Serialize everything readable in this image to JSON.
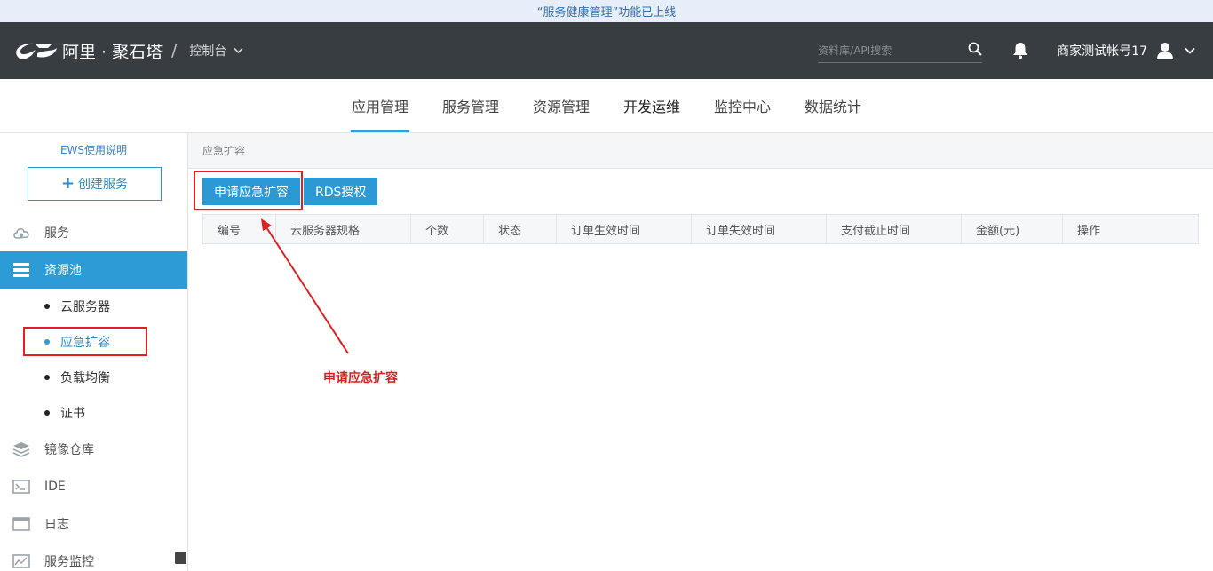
{
  "announcement": "“服务健康管理”功能已上线",
  "header": {
    "brand": "阿里 · 聚石塔",
    "separator": "/",
    "console_label": "控制台",
    "search_placeholder": "资料库/API搜索",
    "account_name": "商家测试帐号17"
  },
  "main_nav": {
    "tabs": [
      {
        "label": "应用管理"
      },
      {
        "label": "服务管理"
      },
      {
        "label": "资源管理"
      },
      {
        "label": "开发运维"
      },
      {
        "label": "监控中心"
      },
      {
        "label": "数据统计"
      }
    ]
  },
  "sidebar": {
    "ews_link": "EWS使用说明",
    "create_plus": "+",
    "create_label": "创建服务",
    "items": [
      {
        "label": "服务"
      },
      {
        "label": "资源池"
      },
      {
        "label": "镜像仓库"
      },
      {
        "label": "IDE"
      },
      {
        "label": "日志"
      },
      {
        "label": "服务监控"
      }
    ],
    "sub_items": [
      {
        "label": "云服务器"
      },
      {
        "label": "应急扩容"
      },
      {
        "label": "负载均衡"
      },
      {
        "label": "证书"
      }
    ]
  },
  "content": {
    "breadcrumb": "应急扩容",
    "buttons": {
      "apply": "申请应急扩容",
      "rds": "RDS授权"
    },
    "columns": [
      "编号",
      "云服务器规格",
      "个数",
      "状态",
      "订单生效时间",
      "订单失效时间",
      "支付截止时间",
      "金额(元)",
      "操作"
    ],
    "annotation": "申请应急扩容"
  },
  "colors": {
    "accent": "#2c9bd6",
    "topbar": "#373d41",
    "highlight": "#e02020"
  }
}
